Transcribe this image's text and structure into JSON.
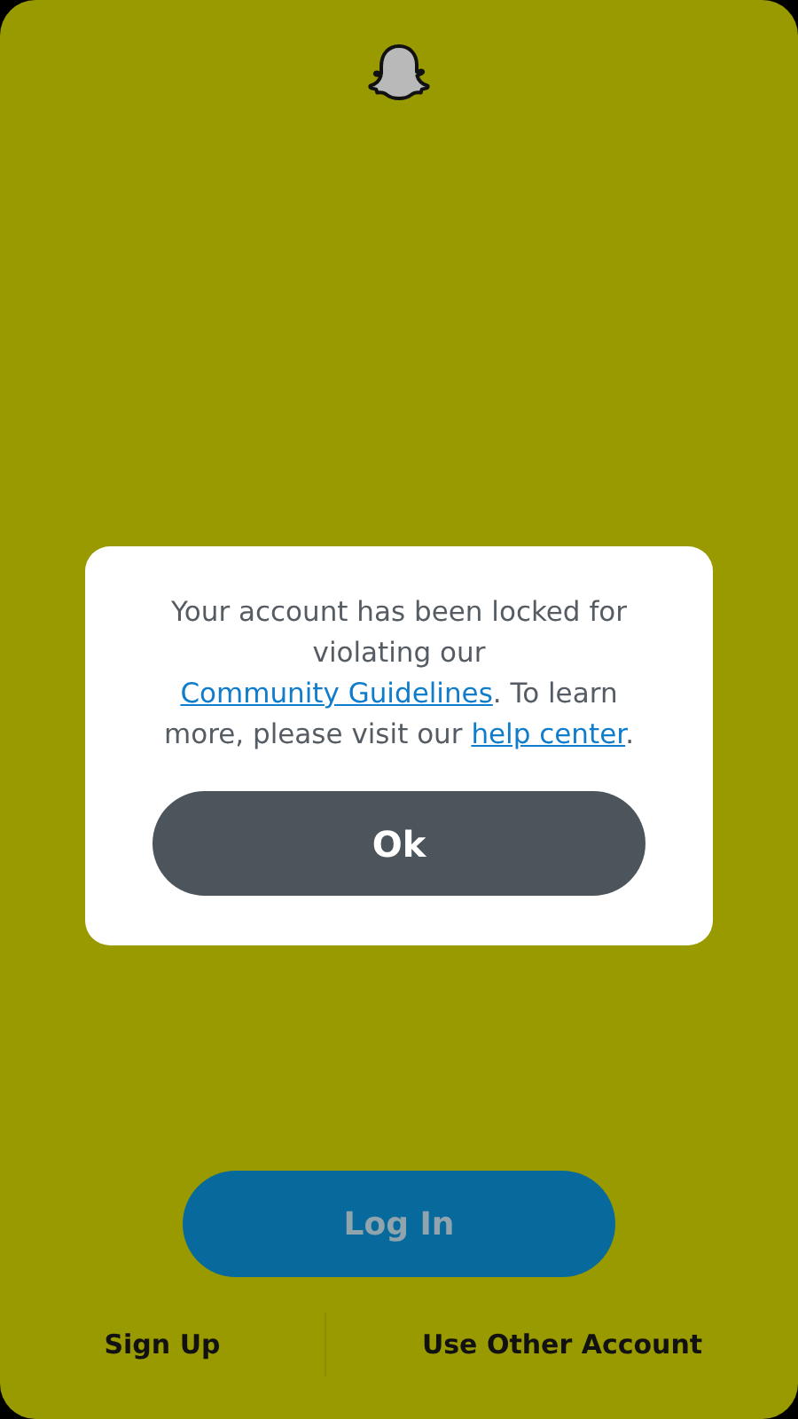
{
  "dialog": {
    "message": [
      {
        "kind": "text",
        "text": "Your account has been locked for violating our "
      },
      {
        "kind": "link",
        "text": "Community Guidelines"
      },
      {
        "kind": "text",
        "text": ". To learn more, please visit our "
      },
      {
        "kind": "link",
        "text": "help center"
      },
      {
        "kind": "text",
        "text": "."
      }
    ],
    "button": "Ok"
  },
  "login_button": {
    "label": "Log In",
    "disabled": true
  },
  "footer": [
    "Sign Up",
    "Use Other Account"
  ]
}
